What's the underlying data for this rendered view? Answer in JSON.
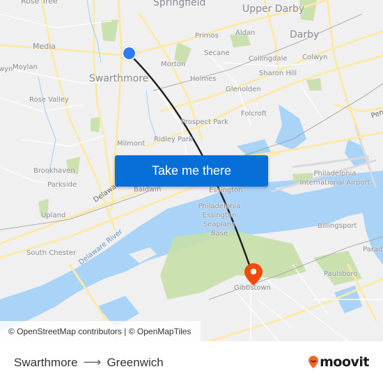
{
  "map": {
    "labels": [
      {
        "text": "Rose Tree",
        "size": "normal"
      },
      {
        "text": "Springfield",
        "size": "big"
      },
      {
        "text": "Upper Darby",
        "size": "big"
      },
      {
        "text": "Darby",
        "size": "big"
      },
      {
        "text": "Media",
        "size": "normal"
      },
      {
        "text": "Primos",
        "size": "normal"
      },
      {
        "text": "Aldan",
        "size": "normal"
      },
      {
        "text": "Secane",
        "size": "normal"
      },
      {
        "text": "Collingdale",
        "size": "normal"
      },
      {
        "text": "Colwyn",
        "size": "normal"
      },
      {
        "text": "Moylan",
        "size": "normal"
      },
      {
        "text": "Morton",
        "size": "normal"
      },
      {
        "text": "Swarthmore",
        "size": "big"
      },
      {
        "text": "Holmes",
        "size": "normal"
      },
      {
        "text": "Sharon Hill",
        "size": "normal"
      },
      {
        "text": "Glenolden",
        "size": "normal"
      },
      {
        "text": "Rose Valley",
        "size": "normal"
      },
      {
        "text": "Folcroft",
        "size": "normal"
      },
      {
        "text": "Prospect Park",
        "size": "normal"
      },
      {
        "text": "Milmont",
        "size": "normal"
      },
      {
        "text": "Ridley Park",
        "size": "normal"
      },
      {
        "text": "Brookhaven",
        "size": "normal"
      },
      {
        "text": "Parkside",
        "size": "normal"
      },
      {
        "text": "Baldwin",
        "size": "normal"
      },
      {
        "text": "Essington",
        "size": "normal"
      },
      {
        "text": "Philadelphia International Airport",
        "size": "normal"
      },
      {
        "text": "Philadelphia Essington Seaplane Base",
        "size": "normal"
      },
      {
        "text": "Upland",
        "size": "normal"
      },
      {
        "text": "Billingsport",
        "size": "normal"
      },
      {
        "text": "South Chester",
        "size": "normal"
      },
      {
        "text": "Delaware River",
        "size": "water"
      },
      {
        "text": "Delaware",
        "size": "normal"
      },
      {
        "text": "Paulsboro",
        "size": "normal"
      },
      {
        "text": "Parad",
        "size": "normal"
      },
      {
        "text": "Gibbstown",
        "size": "normal"
      },
      {
        "text": "Penn",
        "size": "normal"
      },
      {
        "text": "wyn",
        "size": "normal"
      }
    ],
    "origin": {
      "name": "Swarthmore",
      "icon": "origin-dot-icon",
      "color": "#2f7cf0"
    },
    "destination": {
      "name": "Greenwich",
      "icon": "map-pin-icon",
      "color": "#f24a0d"
    },
    "route_line_color": "#1f1f1f",
    "cta_label": "Take me there",
    "attribution": "© OpenStreetMap contributors | © OpenMapTiles"
  },
  "footer": {
    "origin": "Swarthmore",
    "arrow": "⟶",
    "destination": "Greenwich",
    "brand": "moovit",
    "brand_color": "#f26522"
  },
  "colors": {
    "cta_background": "#0770d8",
    "water": "#a9d3f7",
    "park": "#c8dfa8",
    "road": "#fbe9a6"
  }
}
